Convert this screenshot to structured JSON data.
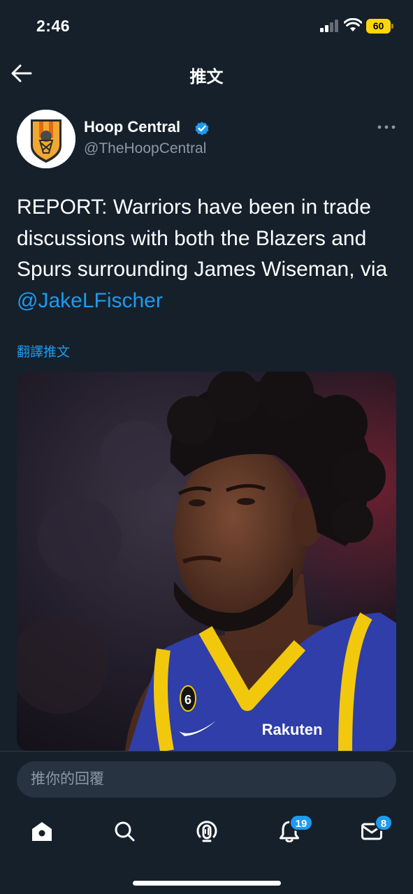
{
  "status_bar": {
    "time": "2:46",
    "battery": "60"
  },
  "nav": {
    "title": "推文",
    "back_icon": "arrow-left-icon"
  },
  "tweet": {
    "author_name": "Hoop Central",
    "author_handle": "@TheHoopCentral",
    "verified": true,
    "text_before_mention": "REPORT: Warriors have been in trade discussions with both the Blazers and Spurs surrounding James Wiseman, via ",
    "mention": "@JakeLFischer",
    "translate_label": "翻譯推文",
    "media": {
      "jersey_number": "6",
      "jersey_sponsor": "Rakuten"
    }
  },
  "reply": {
    "placeholder": "推你的回覆"
  },
  "tab_bar": {
    "items": [
      {
        "name": "home",
        "icon": "home-icon"
      },
      {
        "name": "search",
        "icon": "search-icon"
      },
      {
        "name": "spaces",
        "icon": "spaces-microphone-icon"
      },
      {
        "name": "notifications",
        "icon": "bell-icon",
        "badge": "19"
      },
      {
        "name": "messages",
        "icon": "envelope-icon",
        "badge": "8"
      }
    ]
  },
  "colors": {
    "background": "#15202b",
    "accent": "#1d9bf0",
    "secondary_text": "#8b98a5",
    "battery": "#ffd60a"
  }
}
